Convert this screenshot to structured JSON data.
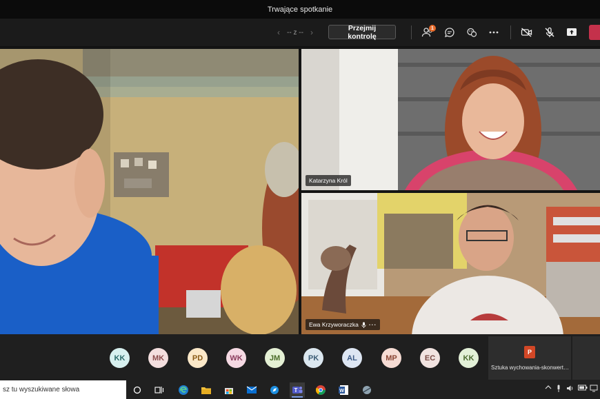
{
  "window": {
    "title": "Trwające spotkanie"
  },
  "toolbar": {
    "pager_text": "-- z --",
    "prev_arrow": "‹",
    "next_arrow": "›",
    "take_control_label": "Przejmij kontrolę",
    "participants_badge": "1"
  },
  "tiles": [
    {
      "name": "Katarzyna Król"
    },
    {
      "name": "Ewa Krzyworaczka",
      "more": "···"
    }
  ],
  "roster": {
    "avatars": [
      {
        "initials": "KK",
        "bg": "#d7f0ef",
        "fg": "#2b6b6a"
      },
      {
        "initials": "MK",
        "bg": "#f3dede",
        "fg": "#8a4b4b"
      },
      {
        "initials": "PD",
        "bg": "#fbe8c8",
        "fg": "#8a5a16"
      },
      {
        "initials": "WK",
        "bg": "#f5d9e3",
        "fg": "#8b3c5d"
      },
      {
        "initials": "JM",
        "bg": "#e4f0d4",
        "fg": "#4a6b27"
      },
      {
        "initials": "PK",
        "bg": "#dbe7ef",
        "fg": "#3c5d76"
      },
      {
        "initials": "AL",
        "bg": "#dde6f3",
        "fg": "#3b5a86"
      },
      {
        "initials": "MP",
        "bg": "#f6dcd4",
        "fg": "#8a4533"
      },
      {
        "initials": "EC",
        "bg": "#f1e3e0",
        "fg": "#7a4b44"
      },
      {
        "initials": "KK",
        "bg": "#e2f0d7",
        "fg": "#4b6b30"
      }
    ],
    "shared_file": "Sztuka wychowania-skonwertowana"
  },
  "taskbar": {
    "search_placeholder": "sz tu wyszukiwane słowa"
  },
  "colors": {
    "accent": "#6264a7",
    "leave": "#c4314b",
    "badge": "#e56a2b"
  }
}
